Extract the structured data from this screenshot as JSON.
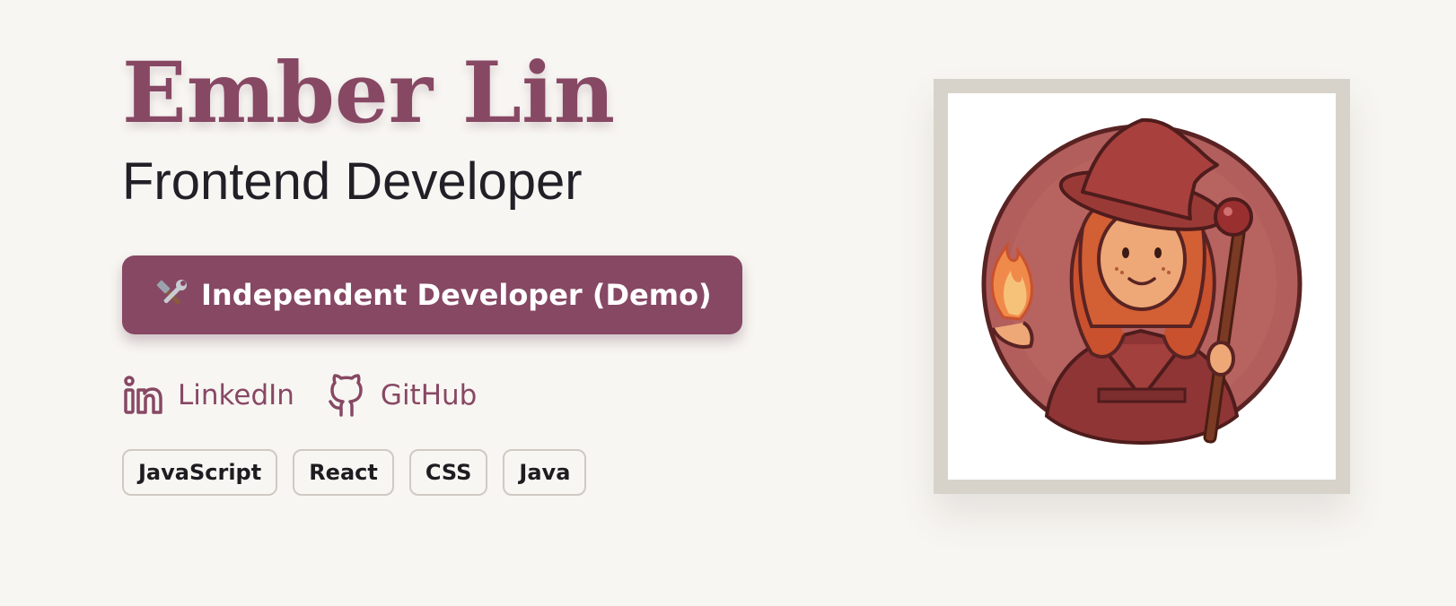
{
  "profile": {
    "name": "Ember Lin",
    "role": "Frontend Developer"
  },
  "cta": {
    "label": "Independent Developer (Demo)",
    "icon": "tools-icon"
  },
  "links": [
    {
      "label": "LinkedIn",
      "icon": "linkedin-icon"
    },
    {
      "label": "GitHub",
      "icon": "github-icon"
    }
  ],
  "skills": [
    "JavaScript",
    "React",
    "CSS",
    "Java"
  ],
  "portrait": {
    "icon": "witch-avatar"
  },
  "colors": {
    "accent": "#874864",
    "background": "#f8f6f2",
    "frame": "#d8d3ca",
    "text": "#222027"
  }
}
